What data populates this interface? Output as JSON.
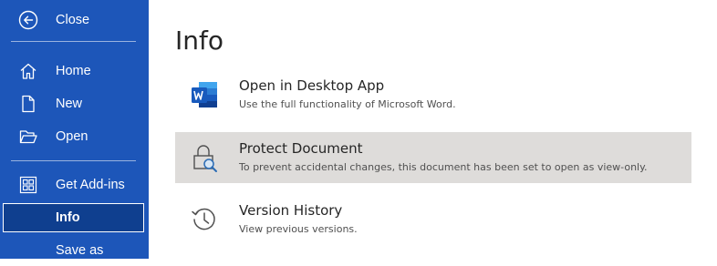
{
  "sidebar": {
    "close_label": "Close",
    "items": [
      {
        "label": "Home",
        "icon": "home-icon"
      },
      {
        "label": "New",
        "icon": "new-document-icon"
      },
      {
        "label": "Open",
        "icon": "folder-open-icon"
      },
      {
        "label": "Get Add-ins",
        "icon": "add-ins-grid-icon"
      },
      {
        "label": "Info",
        "icon": "",
        "selected": true
      },
      {
        "label": "Save as",
        "icon": ""
      }
    ]
  },
  "main": {
    "title": "Info",
    "options": [
      {
        "title": "Open in Desktop App",
        "description": "Use the full functionality of Microsoft Word.",
        "icon": "word-app-icon"
      },
      {
        "title": "Protect Document",
        "description": "To prevent accidental changes, this document has been set to open as view-only.",
        "icon": "lock-search-icon",
        "highlighted": true
      },
      {
        "title": "Version History",
        "description": "View previous versions.",
        "icon": "history-icon"
      }
    ]
  },
  "colors": {
    "sidebar_bg": "#1d56b9",
    "selected_bg": "#0f3f8f",
    "highlight_bg": "#dedcda",
    "word_blue": "#185abd"
  }
}
